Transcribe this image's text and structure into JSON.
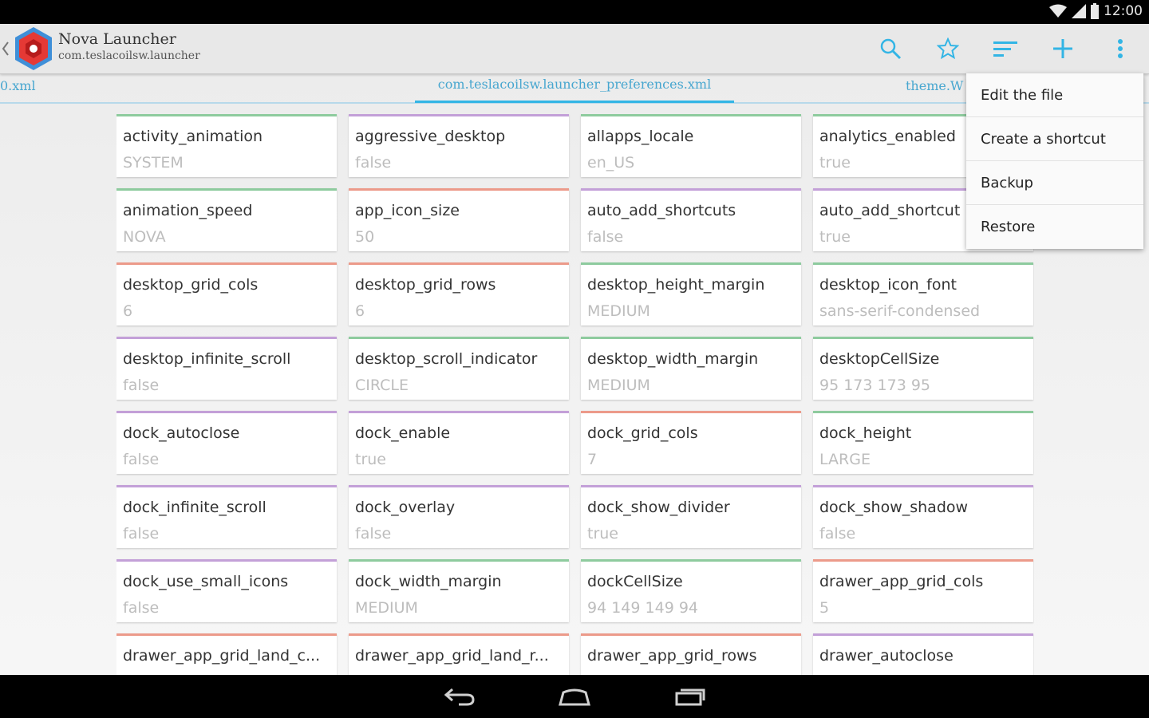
{
  "status": {
    "time": "12:00"
  },
  "app": {
    "title": "Nova Launcher",
    "subtitle": "com.teslacoilsw.launcher"
  },
  "actions": [
    "search-icon",
    "star-icon",
    "sort-icon",
    "add-icon",
    "overflow-icon"
  ],
  "tabs": {
    "left": "0.xml",
    "active": "com.teslacoilsw.launcher_preferences.xml",
    "right": "theme.W"
  },
  "menu": {
    "items": [
      "Edit the file",
      "Create a shortcut",
      "Backup",
      "Restore"
    ]
  },
  "colors": {
    "accent": "#33b5e5",
    "green": "#8ecb9e",
    "red": "#ec9a8a",
    "purple": "#c3a0d8"
  },
  "prefs": [
    {
      "key": "activity_animation",
      "value": "SYSTEM",
      "color": "green"
    },
    {
      "key": "aggressive_desktop",
      "value": "false",
      "color": "purple"
    },
    {
      "key": "allapps_locale",
      "value": "en_US",
      "color": "green"
    },
    {
      "key": "analytics_enabled",
      "value": "true",
      "color": "green"
    },
    {
      "key": "animation_speed",
      "value": "NOVA",
      "color": "green"
    },
    {
      "key": "app_icon_size",
      "value": "50",
      "color": "red"
    },
    {
      "key": "auto_add_shortcuts",
      "value": "false",
      "color": "purple"
    },
    {
      "key": "auto_add_shortcut",
      "value": "true",
      "color": "purple"
    },
    {
      "key": "desktop_grid_cols",
      "value": "6",
      "color": "red"
    },
    {
      "key": "desktop_grid_rows",
      "value": "6",
      "color": "red"
    },
    {
      "key": "desktop_height_margin",
      "value": "MEDIUM",
      "color": "green"
    },
    {
      "key": "desktop_icon_font",
      "value": "sans-serif-condensed",
      "color": "green"
    },
    {
      "key": "desktop_infinite_scroll",
      "value": "false",
      "color": "purple"
    },
    {
      "key": "desktop_scroll_indicator",
      "value": "CIRCLE",
      "color": "green"
    },
    {
      "key": "desktop_width_margin",
      "value": "MEDIUM",
      "color": "green"
    },
    {
      "key": "desktopCellSize",
      "value": "95 173 173 95",
      "color": "green"
    },
    {
      "key": "dock_autoclose",
      "value": "false",
      "color": "purple"
    },
    {
      "key": "dock_enable",
      "value": "true",
      "color": "purple"
    },
    {
      "key": "dock_grid_cols",
      "value": "7",
      "color": "red"
    },
    {
      "key": "dock_height",
      "value": "LARGE",
      "color": "green"
    },
    {
      "key": "dock_infinite_scroll",
      "value": "false",
      "color": "purple"
    },
    {
      "key": "dock_overlay",
      "value": "false",
      "color": "purple"
    },
    {
      "key": "dock_show_divider",
      "value": "true",
      "color": "purple"
    },
    {
      "key": "dock_show_shadow",
      "value": "false",
      "color": "purple"
    },
    {
      "key": "dock_use_small_icons",
      "value": "false",
      "color": "purple"
    },
    {
      "key": "dock_width_margin",
      "value": "MEDIUM",
      "color": "green"
    },
    {
      "key": "dockCellSize",
      "value": "94 149 149 94",
      "color": "green"
    },
    {
      "key": "drawer_app_grid_cols",
      "value": "5",
      "color": "red"
    },
    {
      "key": "drawer_app_grid_land_c...",
      "value": "",
      "color": "red"
    },
    {
      "key": "drawer_app_grid_land_r...",
      "value": "",
      "color": "red"
    },
    {
      "key": "drawer_app_grid_rows",
      "value": "",
      "color": "red"
    },
    {
      "key": "drawer_autoclose",
      "value": "",
      "color": "purple"
    }
  ],
  "nav": [
    "back-icon",
    "home-icon",
    "recents-icon"
  ]
}
